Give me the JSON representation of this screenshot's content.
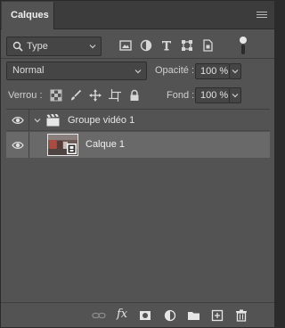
{
  "panel": {
    "tab_title": "Calques"
  },
  "filter": {
    "kind_label": "Type",
    "icons": [
      "pixel-filter-icon",
      "adjustment-filter-icon",
      "type-filter-icon",
      "shape-filter-icon",
      "smart-object-filter-icon"
    ]
  },
  "blend": {
    "mode": "Normal",
    "opacity_label": "Opacité :",
    "opacity_value": "100 %"
  },
  "lock": {
    "label": "Verrou :",
    "fill_label": "Fond :",
    "fill_value": "100 %"
  },
  "layers": [
    {
      "name": "Groupe vidéo 1",
      "type": "video-group",
      "visible": true,
      "expanded": true
    },
    {
      "name": "Calque 1",
      "type": "video-layer",
      "visible": true,
      "selected": true
    }
  ],
  "bottom_toolbar": {
    "fx_label": "fx",
    "icons": [
      "link-layers-icon",
      "layer-style-icon",
      "add-mask-icon",
      "adjustment-layer-icon",
      "new-group-icon",
      "new-layer-icon",
      "delete-layer-icon"
    ]
  }
}
